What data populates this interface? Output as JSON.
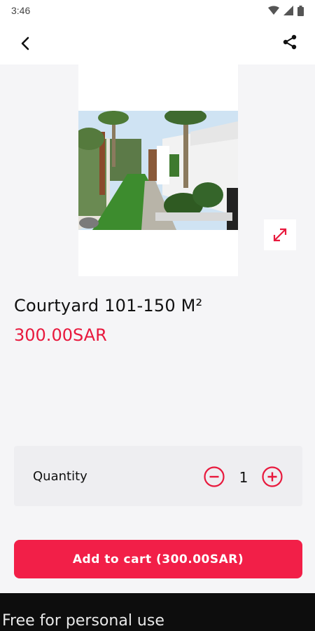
{
  "status_bar": {
    "time": "3:46",
    "icons": [
      "wifi-icon",
      "signal-icon",
      "battery-icon"
    ]
  },
  "app_bar": {
    "back_icon": "back-arrow-icon",
    "share_icon": "share-icon"
  },
  "product": {
    "image_alt": "courtyard-photo",
    "title": "Courtyard 101-150 M²",
    "price": "300.00SAR",
    "expand_icon": "expand-icon"
  },
  "quantity": {
    "label": "Quantity",
    "value": "1",
    "minus_icon": "minus-circle-icon",
    "plus_icon": "plus-circle-icon"
  },
  "cart": {
    "button_label": "Add to cart (300.00SAR)"
  },
  "watermark": {
    "text": "Free for personal use"
  },
  "colors": {
    "accent": "#f21f48",
    "price": "#e8193d",
    "background": "#f5f5f7"
  }
}
